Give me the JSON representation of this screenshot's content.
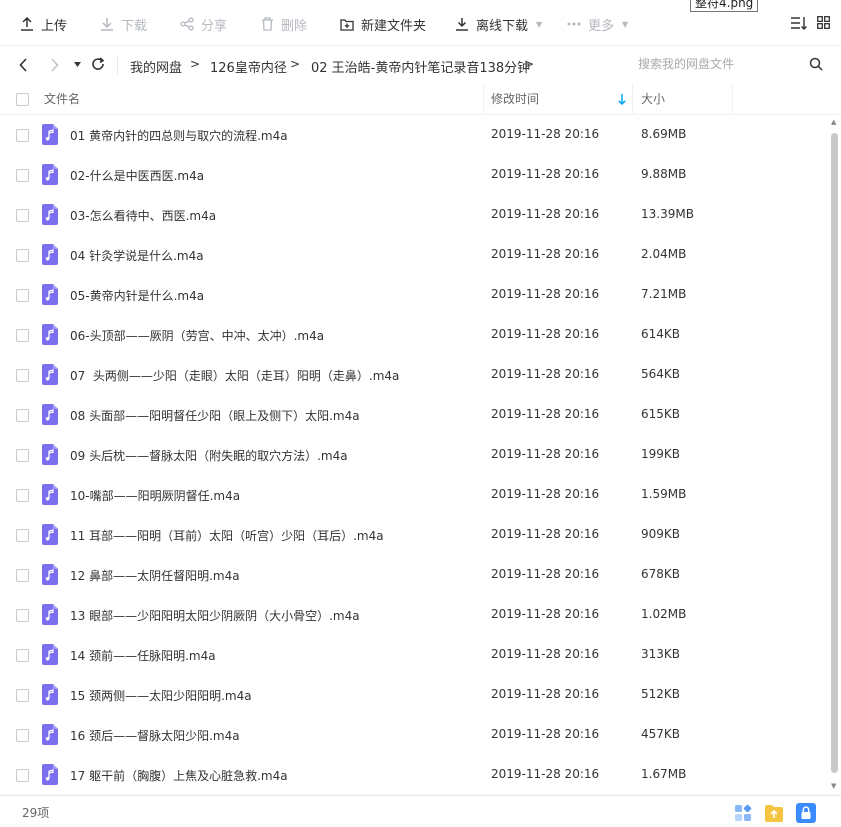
{
  "toolbar": {
    "upload": "上传",
    "download": "下载",
    "share": "分享",
    "delete": "删除",
    "new_folder": "新建文件夹",
    "offline_download": "离线下载",
    "more": "更多",
    "tooltip": "整符4.png"
  },
  "breadcrumb": {
    "items": [
      "我的网盘",
      "126皇帝内径",
      "02 王治皓-黄帝内针笔记录音138分钟"
    ],
    "separator": ">"
  },
  "search": {
    "placeholder": "搜索我的网盘文件"
  },
  "table": {
    "headers": {
      "name": "文件名",
      "modified": "修改时间",
      "size": "大小"
    },
    "rows": [
      {
        "name": "01 黄帝内针的四总则与取穴的流程.m4a",
        "modified": "2019-11-28 20:16",
        "size": "8.69MB"
      },
      {
        "name": "02-什么是中医西医.m4a",
        "modified": "2019-11-28 20:16",
        "size": "9.88MB"
      },
      {
        "name": "03-怎么看待中、西医.m4a",
        "modified": "2019-11-28 20:16",
        "size": "13.39MB"
      },
      {
        "name": "04 针灸学说是什么.m4a",
        "modified": "2019-11-28 20:16",
        "size": "2.04MB"
      },
      {
        "name": "05-黄帝内针是什么.m4a",
        "modified": "2019-11-28 20:16",
        "size": "7.21MB"
      },
      {
        "name": "06-头顶部——厥阴（劳宫、中冲、太冲）.m4a",
        "modified": "2019-11-28 20:16",
        "size": "614KB"
      },
      {
        "name": "07  头两侧——少阳（走眼）太阳（走耳）阳明（走鼻）.m4a",
        "modified": "2019-11-28 20:16",
        "size": "564KB"
      },
      {
        "name": "08 头面部——阳明督任少阳（眼上及侧下）太阳.m4a",
        "modified": "2019-11-28 20:16",
        "size": "615KB"
      },
      {
        "name": "09 头后枕——督脉太阳（附失眠的取穴方法）.m4a",
        "modified": "2019-11-28 20:16",
        "size": "199KB"
      },
      {
        "name": "10-嘴部——阳明厥阴督任.m4a",
        "modified": "2019-11-28 20:16",
        "size": "1.59MB"
      },
      {
        "name": "11 耳部——阳明（耳前）太阳（听宫）少阳（耳后）.m4a",
        "modified": "2019-11-28 20:16",
        "size": "909KB"
      },
      {
        "name": "12 鼻部——太阴任督阳明.m4a",
        "modified": "2019-11-28 20:16",
        "size": "678KB"
      },
      {
        "name": "13 眼部——少阳阳明太阳少阴厥阴（大小骨空）.m4a",
        "modified": "2019-11-28 20:16",
        "size": "1.02MB"
      },
      {
        "name": "14 颈前——任脉阳明.m4a",
        "modified": "2019-11-28 20:16",
        "size": "313KB"
      },
      {
        "name": "15 颈两侧——太阳少阳阳明.m4a",
        "modified": "2019-11-28 20:16",
        "size": "512KB"
      },
      {
        "name": "16 颈后——督脉太阳少阳.m4a",
        "modified": "2019-11-28 20:16",
        "size": "457KB"
      },
      {
        "name": "17 躯干前（胸腹）上焦及心脏急救.m4a",
        "modified": "2019-11-28 20:16",
        "size": "1.67MB"
      }
    ]
  },
  "footer": {
    "count": "29项"
  },
  "colors": {
    "accent": "#06a7ff",
    "file_icon": "#7b6ff0",
    "folder_yellow": "#f5c542",
    "lock_blue": "#3b8cff"
  }
}
